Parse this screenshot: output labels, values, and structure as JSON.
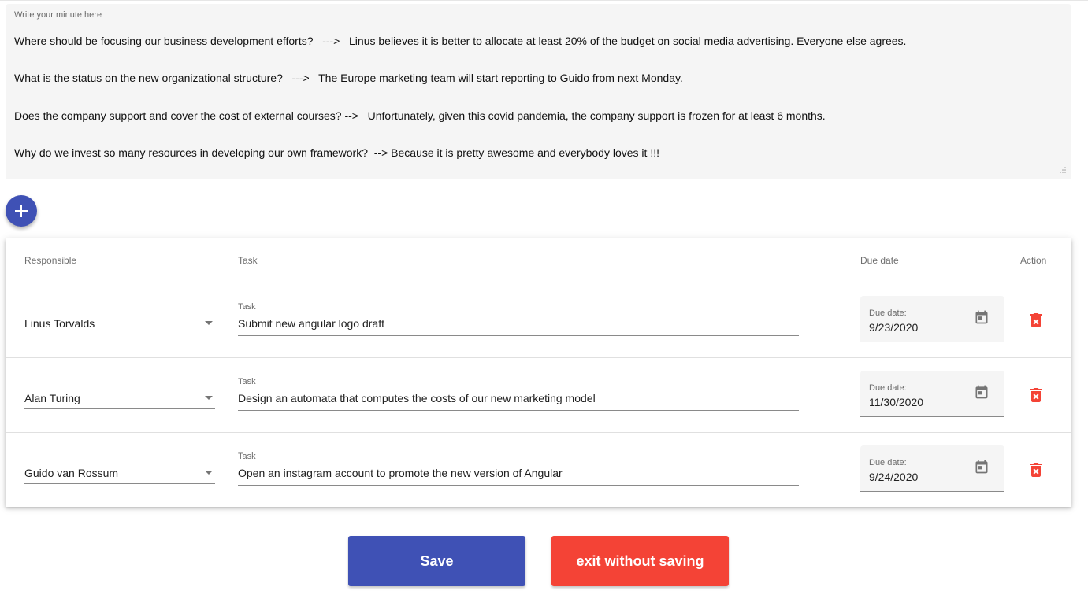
{
  "minutes": {
    "label": "Write your minute here",
    "lines": [
      "Where should be focusing our business development efforts?   --->   Linus believes it is better to allocate at least 20% of the budget on social media advertising. Everyone else agrees.",
      "What is the status on the new organizational structure?   --->   The Europe marketing team will start reporting to Guido from next Monday.",
      "Does the company support and cover the cost of external courses? -->   Unfortunately, given this covid pandemia, the company support is frozen for at least 6 months.",
      "Why do we invest so many resources in developing our own framework?  --> Because it is pretty awesome and everybody loves it !!!"
    ]
  },
  "add_button": {
    "icon": "plus-icon"
  },
  "table": {
    "headers": {
      "responsible": "Responsible",
      "task": "Task",
      "due_date": "Due date",
      "action": "Action"
    },
    "rows": [
      {
        "responsible": "Linus Torvalds",
        "task_label": "Task",
        "task": "Submit new angular logo draft",
        "due_label": "Due date:",
        "due": "9/23/2020"
      },
      {
        "responsible": "Alan Turing",
        "task_label": "Task",
        "task": "Design an automata that computes the costs of our new marketing model",
        "due_label": "Due date:",
        "due": "11/30/2020"
      },
      {
        "responsible": "Guido van Rossum",
        "task_label": "Task",
        "task": "Open an instagram account to promote the new version of Angular",
        "due_label": "Due date:",
        "due": "9/24/2020"
      }
    ]
  },
  "buttons": {
    "save": "Save",
    "exit": "exit without saving"
  },
  "colors": {
    "primary": "#3f51b5",
    "warn": "#f44336",
    "icon_grey": "#757575"
  }
}
